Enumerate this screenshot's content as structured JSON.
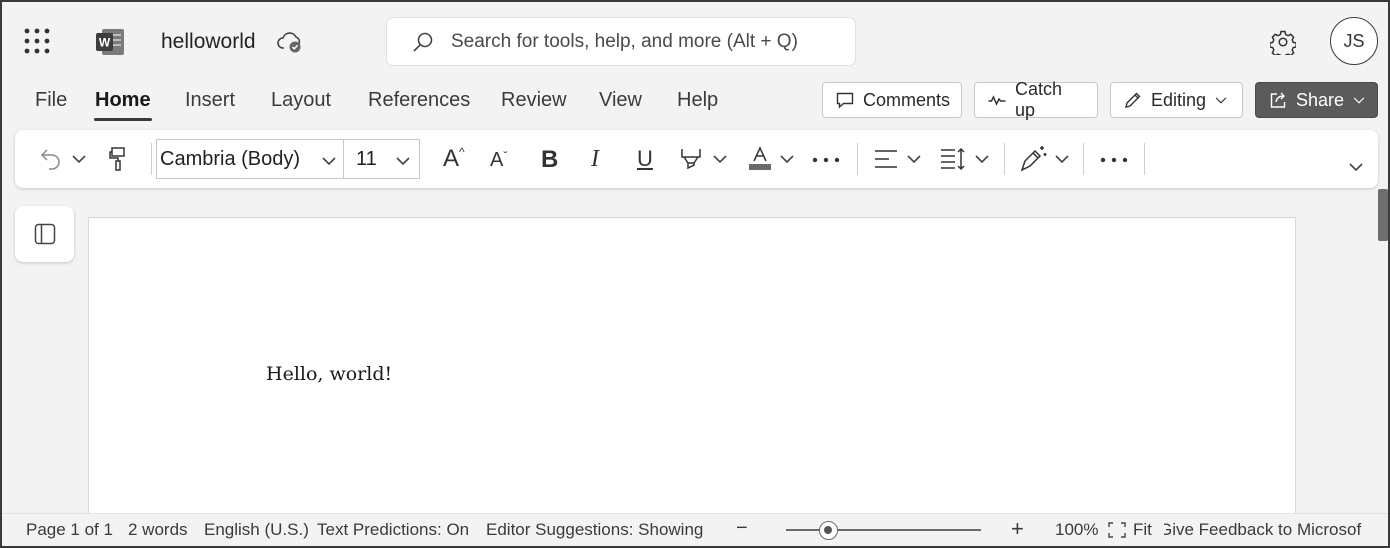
{
  "app": {
    "document_title": "helloworld",
    "search_placeholder": "Search for tools, help, and more (Alt + Q)",
    "avatar_initials": "JS"
  },
  "tabs": [
    {
      "label": "File"
    },
    {
      "label": "Home",
      "active": true
    },
    {
      "label": "Insert"
    },
    {
      "label": "Layout"
    },
    {
      "label": "References"
    },
    {
      "label": "Review"
    },
    {
      "label": "View"
    },
    {
      "label": "Help"
    }
  ],
  "actions": {
    "comments": "Comments",
    "catch_up": "Catch up",
    "editing": "Editing",
    "share": "Share"
  },
  "ribbon": {
    "font_name": "Cambria (Body)",
    "font_size": "11",
    "bold": "B",
    "italic": "I",
    "underline": "U",
    "grow_font": "A",
    "shrink_font": "A"
  },
  "document": {
    "body_text": "Hello, world!"
  },
  "statusbar": {
    "page": "Page 1 of 1",
    "words": "2 words",
    "language": "English (U.S.)",
    "text_predictions": "Text Predictions: On",
    "editor_suggestions": "Editor Suggestions: Showing",
    "zoom_out": "−",
    "zoom_in": "+",
    "zoom_level": "100%",
    "fit": "Fit",
    "feedback": "Give Feedback to Microsof",
    "zoom_slider_fraction": 0.22
  },
  "colors": {
    "share_bg": "#5b5b5b",
    "background": "#f3f3f3"
  }
}
